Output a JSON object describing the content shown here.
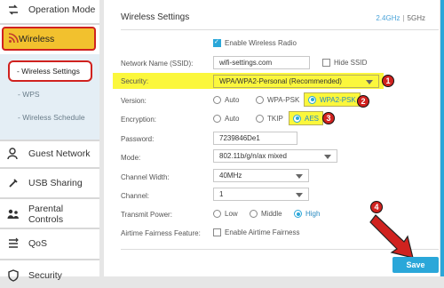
{
  "sidebar": {
    "items": [
      {
        "label": "Operation Mode",
        "icon": "operation-mode-icon"
      },
      {
        "label": "Wireless",
        "icon": "wifi-icon"
      },
      {
        "label": "Guest Network",
        "icon": "guest-user-icon"
      },
      {
        "label": "USB Sharing",
        "icon": "usb-icon"
      },
      {
        "label": "Parental Controls",
        "icon": "parental-controls-icon"
      },
      {
        "label": "QoS",
        "icon": "qos-icon"
      },
      {
        "label": "Security",
        "icon": "security-icon"
      }
    ],
    "submenu": [
      {
        "label": "- Wireless Settings"
      },
      {
        "label": "- WPS"
      },
      {
        "label": "- Wireless Schedule"
      }
    ]
  },
  "main": {
    "title": "Wireless Settings",
    "band_24": "2.4GHz",
    "band_sep": "|",
    "band_5": "5GHz",
    "enable_radio_label": "Enable Wireless Radio",
    "fields": {
      "network_name_label": "Network Name (SSID):",
      "network_name_value": "wifi-settings.com",
      "hide_ssid_label": "Hide SSID",
      "security_label": "Security:",
      "security_value": "WPA/WPA2-Personal (Recommended)",
      "version_label": "Version:",
      "version_options": [
        "Auto",
        "WPA-PSK",
        "WPA2-PSK"
      ],
      "encryption_label": "Encryption:",
      "encryption_options": [
        "Auto",
        "TKIP",
        "AES"
      ],
      "password_label": "Password:",
      "password_value": "7239846De1",
      "mode_label": "Mode:",
      "mode_value": "802.11b/g/n/ax mixed",
      "channel_width_label": "Channel Width:",
      "channel_width_value": "40MHz",
      "channel_label": "Channel:",
      "channel_value": "1",
      "tx_power_label": "Transmit Power:",
      "tx_power_options": [
        "Low",
        "Middle",
        "High"
      ],
      "airtime_label": "Airtime Fairness Feature:",
      "airtime_option": "Enable Airtime Fairness"
    },
    "save_label": "Save"
  },
  "callouts": [
    "1",
    "2",
    "3",
    "4"
  ],
  "colors": {
    "accent": "#2aa7d9",
    "highlight": "#fbf73c",
    "wireless_bg": "#f2c12e",
    "callout_red": "#d0221f"
  }
}
